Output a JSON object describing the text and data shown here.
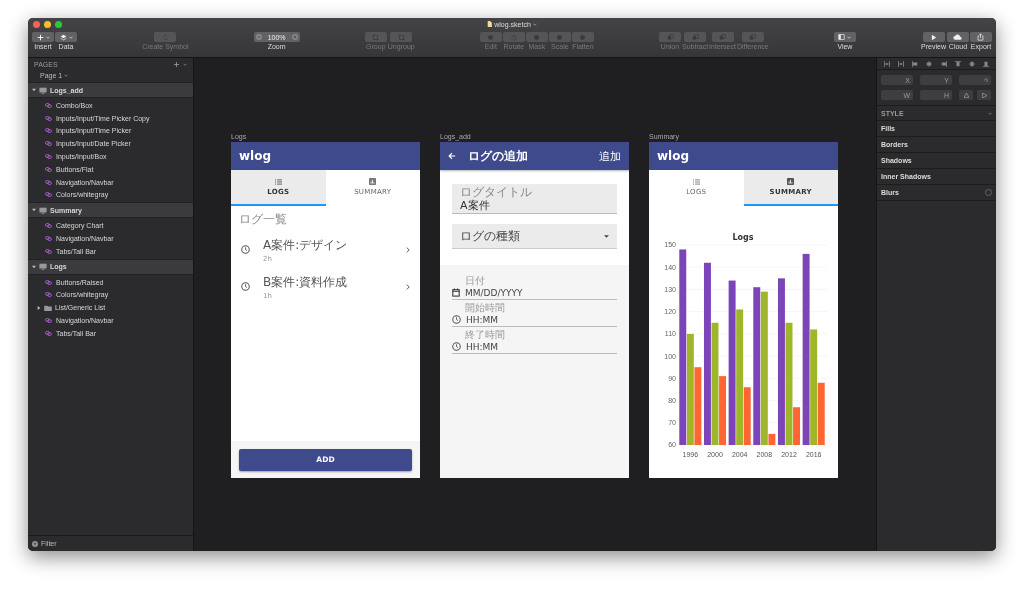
{
  "window": {
    "title": "wlog.sketch"
  },
  "toolbar": {
    "sections": [
      [
        {
          "kind": "button",
          "label": "Insert",
          "disabled": false,
          "caret": true
        },
        {
          "kind": "button",
          "label": "Data",
          "disabled": false,
          "caret": true
        }
      ],
      [
        {
          "kind": "button",
          "label": "Create Symbol",
          "disabled": true,
          "caret": false
        }
      ],
      [
        {
          "kind": "zoom",
          "label": "Zoom",
          "value": "100%"
        }
      ],
      [
        {
          "kind": "button",
          "label": "Group",
          "disabled": true,
          "caret": false
        },
        {
          "kind": "button",
          "label": "Ungroup",
          "disabled": true,
          "caret": false
        }
      ],
      [
        {
          "kind": "button",
          "label": "Edit",
          "disabled": true,
          "caret": false
        },
        {
          "kind": "button",
          "label": "Rotate",
          "disabled": true,
          "caret": false
        },
        {
          "kind": "button",
          "label": "Mask",
          "disabled": true,
          "caret": false
        },
        {
          "kind": "button",
          "label": "Scale",
          "disabled": true,
          "caret": false
        },
        {
          "kind": "button",
          "label": "Flatten",
          "disabled": true,
          "caret": false
        }
      ],
      [
        {
          "kind": "button",
          "label": "Union",
          "disabled": true,
          "caret": false
        },
        {
          "kind": "button",
          "label": "Subtract",
          "disabled": true,
          "caret": false
        },
        {
          "kind": "button",
          "label": "Intersect",
          "disabled": true,
          "caret": false
        },
        {
          "kind": "button",
          "label": "Difference",
          "disabled": true,
          "caret": false
        }
      ],
      [
        {
          "kind": "button",
          "label": "View",
          "disabled": false,
          "caret": true
        }
      ],
      [
        {
          "kind": "button",
          "label": "Preview",
          "disabled": false,
          "caret": false
        },
        {
          "kind": "button",
          "label": "Cloud",
          "disabled": false,
          "caret": false
        },
        {
          "kind": "button",
          "label": "Export",
          "disabled": false,
          "caret": false
        }
      ]
    ]
  },
  "sidebar": {
    "header": "PAGES",
    "page": "Page 1",
    "filter": "Filter",
    "layers": [
      {
        "kind": "artboard",
        "name": "Logs_add",
        "expanded": true,
        "children": [
          {
            "kind": "symbol",
            "name": "Combo/Box"
          },
          {
            "kind": "symbol",
            "name": "Inputs/Input/Time Picker Copy"
          },
          {
            "kind": "symbol",
            "name": "Inputs/Input/Time Picker"
          },
          {
            "kind": "symbol",
            "name": "Inputs/Input/Date Picker"
          },
          {
            "kind": "symbol",
            "name": "Inputs/Input/Box"
          },
          {
            "kind": "symbol",
            "name": "Buttons/Flat"
          },
          {
            "kind": "symbol",
            "name": "Navigation/Navbar"
          },
          {
            "kind": "symbol",
            "name": "Colors/whitegray"
          }
        ]
      },
      {
        "kind": "artboard",
        "name": "Summary",
        "expanded": true,
        "children": [
          {
            "kind": "symbol",
            "name": "Category Chart"
          },
          {
            "kind": "symbol",
            "name": "Navigation/Navbar"
          },
          {
            "kind": "symbol",
            "name": "Tabs/Tall Bar"
          }
        ]
      },
      {
        "kind": "artboard",
        "name": "Logs",
        "expanded": true,
        "children": [
          {
            "kind": "symbol",
            "name": "Buttons/Raised"
          },
          {
            "kind": "symbol",
            "name": "Colors/whitegray"
          },
          {
            "kind": "group",
            "name": "List/Generic List",
            "expanded": false
          },
          {
            "kind": "symbol",
            "name": "Navigation/Navbar"
          },
          {
            "kind": "symbol",
            "name": "Tabs/Tall Bar"
          }
        ]
      }
    ]
  },
  "artboards": [
    {
      "kind": "logs",
      "label": "Logs",
      "navbar": {
        "title": "wlog"
      },
      "tabs": [
        {
          "label": "LOGS",
          "selected": true
        },
        {
          "label": "SUMMARY",
          "selected": false
        }
      ],
      "section_label": "ログ一覧",
      "list": [
        {
          "title": "A案件:デザイン",
          "subtitle": "2h"
        },
        {
          "title": "B案件:資料作成",
          "subtitle": "1h"
        }
      ],
      "button": "ADD"
    },
    {
      "kind": "form",
      "label": "Logs_add",
      "navbar": {
        "title": "ログの追加",
        "action": "追加"
      },
      "title_field": {
        "label": "ログタイトル",
        "value": "A案件"
      },
      "type_select": {
        "placeholder": "ログの種類"
      },
      "pickers": [
        {
          "kind": "date",
          "label": "日付",
          "placeholder": "MM/DD/YYYY"
        },
        {
          "kind": "time",
          "label": "開始時間",
          "placeholder": "HH:MM"
        },
        {
          "kind": "time",
          "label": "終了時間",
          "placeholder": "HH:MM"
        }
      ]
    },
    {
      "kind": "summary",
      "label": "Summary",
      "navbar": {
        "title": "wlog"
      },
      "tabs": [
        {
          "label": "LOGS",
          "selected": false
        },
        {
          "label": "SUMMARY",
          "selected": true
        }
      ],
      "chart_data": {
        "type": "bar",
        "title": "Logs",
        "categories": [
          "1996",
          "2000",
          "2004",
          "2008",
          "2012",
          "2016"
        ],
        "series": [
          {
            "color": "#7b44b8",
            "values": [
              148,
              142,
              134,
              131,
              135,
              146
            ]
          },
          {
            "color": "#9fb52a",
            "values": [
              110,
              115,
              121,
              129,
              115,
              112
            ]
          },
          {
            "color": "#ff6633",
            "values": [
              95,
              91,
              86,
              65,
              77,
              88
            ]
          }
        ],
        "grid": true,
        "ylim": [
          60,
          150
        ],
        "yticks": [
          60,
          70,
          80,
          90,
          100,
          110,
          120,
          130,
          140,
          150
        ]
      }
    }
  ],
  "inspector": {
    "position_fields": [
      "X",
      "Y"
    ],
    "size_fields": [
      "W",
      "H"
    ],
    "style_header": "STYLE",
    "style_sections": [
      {
        "kind": "section",
        "label": "Fills"
      },
      {
        "kind": "section",
        "label": "Borders"
      },
      {
        "kind": "section",
        "label": "Shadows"
      },
      {
        "kind": "section",
        "label": "Inner Shadows"
      },
      {
        "kind": "toggle_section",
        "label": "Blurs",
        "checked": false
      }
    ]
  }
}
